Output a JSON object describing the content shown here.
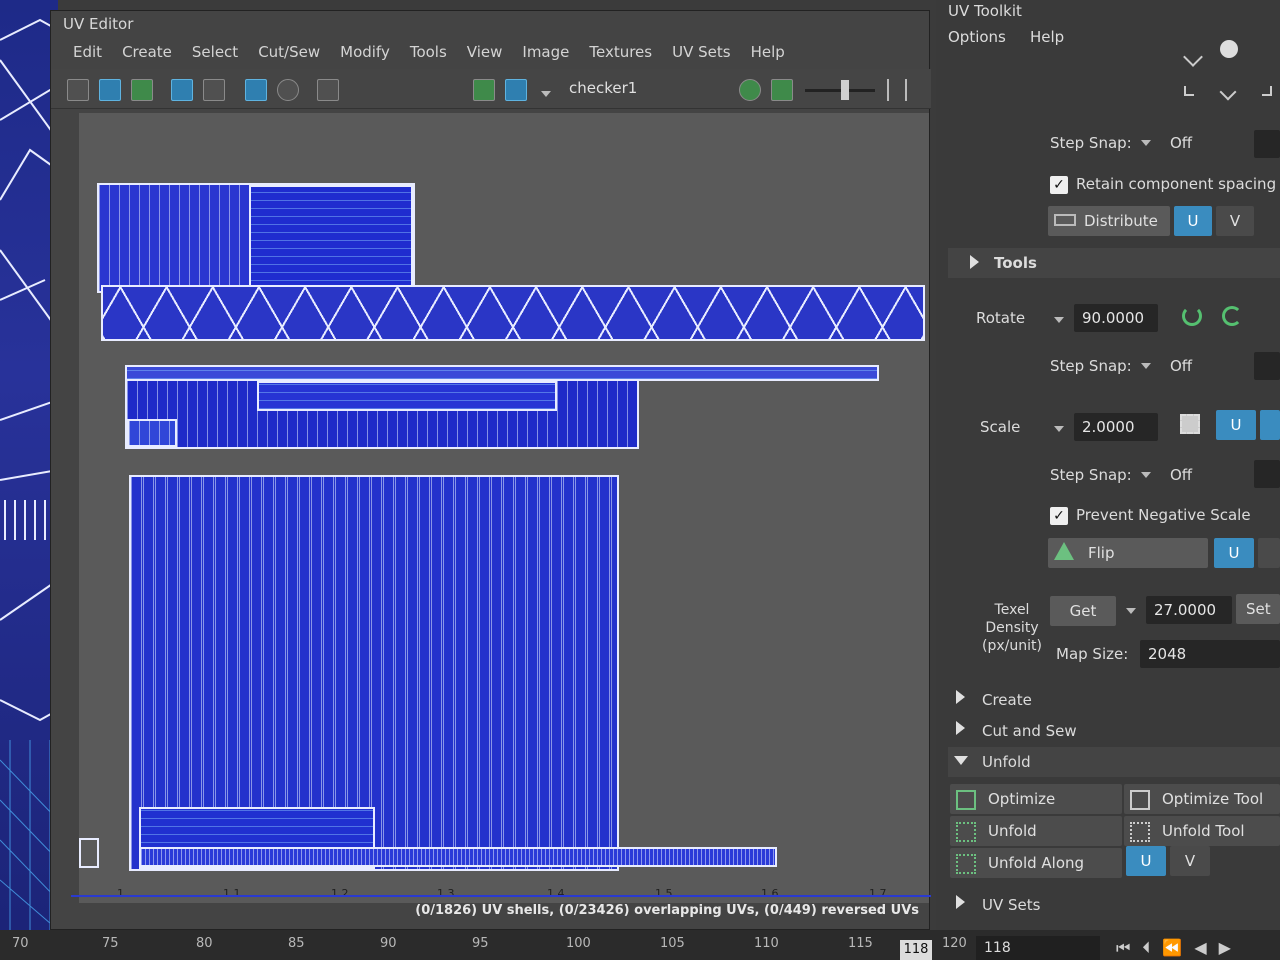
{
  "uv_editor": {
    "title": "UV Editor",
    "menu": [
      "Edit",
      "Create",
      "Select",
      "Cut/Sew",
      "Modify",
      "Tools",
      "View",
      "Image",
      "Textures",
      "UV Sets",
      "Help"
    ],
    "texture_name": "checker1",
    "ruler_labels": [
      "1",
      "1.1",
      "1.2",
      "1.3",
      "1.4",
      "1.5",
      "1.6",
      "1.7"
    ],
    "status": "(0/1826) UV shells, (0/23426) overlapping UVs, (0/449) reversed UVs"
  },
  "toolkit": {
    "title": "UV Toolkit",
    "menu": [
      "Options",
      "Help"
    ],
    "step_snap_label": "Step Snap:",
    "step_snap_value": "Off",
    "retain_spacing_label": "Retain component spacing",
    "distribute_label": "Distribute",
    "u_label": "U",
    "v_label": "V",
    "tools_section": "Tools",
    "rotate_label": "Rotate",
    "rotate_value": "90.0000",
    "scale_label": "Scale",
    "scale_value": "2.0000",
    "prevent_negative_label": "Prevent Negative Scale",
    "flip_label": "Flip",
    "texel_density_label": "Texel Density (px/unit)",
    "get_label": "Get",
    "texel_value": "27.0000",
    "set_label": "Set",
    "map_size_label": "Map Size:",
    "map_size_value": "2048",
    "sections": {
      "create": "Create",
      "cut_and_sew": "Cut and Sew",
      "unfold": "Unfold",
      "uv_sets": "UV Sets"
    },
    "unfold_buttons": {
      "optimize": "Optimize",
      "optimize_tool": "Optimize Tool",
      "unfold": "Unfold",
      "unfold_tool": "Unfold Tool",
      "unfold_along": "Unfold Along"
    }
  },
  "timeline": {
    "ticks": [
      "70",
      "75",
      "80",
      "85",
      "90",
      "95",
      "100",
      "105",
      "110",
      "115",
      "120"
    ],
    "current_frame": "118",
    "frame_field": "118"
  }
}
